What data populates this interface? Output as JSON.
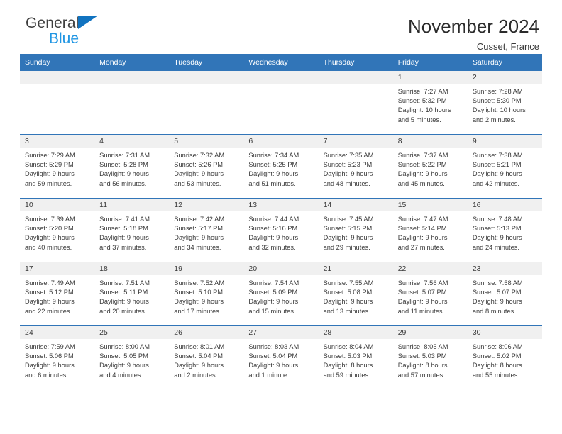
{
  "brand": {
    "name_part1": "General",
    "name_part2": "Blue",
    "triangle_color": "#1173c0",
    "blue_color": "#2196e3"
  },
  "header": {
    "title": "November 2024",
    "subtitle": "Cusset, France"
  },
  "theme": {
    "header_blue": "#3175b8",
    "day_band_gray": "#f0f0f0",
    "text_color": "#3a3a3a"
  },
  "weekdays": [
    "Sunday",
    "Monday",
    "Tuesday",
    "Wednesday",
    "Thursday",
    "Friday",
    "Saturday"
  ],
  "weeks": [
    [
      {
        "day": "",
        "lines": []
      },
      {
        "day": "",
        "lines": []
      },
      {
        "day": "",
        "lines": []
      },
      {
        "day": "",
        "lines": []
      },
      {
        "day": "",
        "lines": []
      },
      {
        "day": "1",
        "lines": [
          "Sunrise: 7:27 AM",
          "Sunset: 5:32 PM",
          "Daylight: 10 hours",
          "and 5 minutes."
        ]
      },
      {
        "day": "2",
        "lines": [
          "Sunrise: 7:28 AM",
          "Sunset: 5:30 PM",
          "Daylight: 10 hours",
          "and 2 minutes."
        ]
      }
    ],
    [
      {
        "day": "3",
        "lines": [
          "Sunrise: 7:29 AM",
          "Sunset: 5:29 PM",
          "Daylight: 9 hours",
          "and 59 minutes."
        ]
      },
      {
        "day": "4",
        "lines": [
          "Sunrise: 7:31 AM",
          "Sunset: 5:28 PM",
          "Daylight: 9 hours",
          "and 56 minutes."
        ]
      },
      {
        "day": "5",
        "lines": [
          "Sunrise: 7:32 AM",
          "Sunset: 5:26 PM",
          "Daylight: 9 hours",
          "and 53 minutes."
        ]
      },
      {
        "day": "6",
        "lines": [
          "Sunrise: 7:34 AM",
          "Sunset: 5:25 PM",
          "Daylight: 9 hours",
          "and 51 minutes."
        ]
      },
      {
        "day": "7",
        "lines": [
          "Sunrise: 7:35 AM",
          "Sunset: 5:23 PM",
          "Daylight: 9 hours",
          "and 48 minutes."
        ]
      },
      {
        "day": "8",
        "lines": [
          "Sunrise: 7:37 AM",
          "Sunset: 5:22 PM",
          "Daylight: 9 hours",
          "and 45 minutes."
        ]
      },
      {
        "day": "9",
        "lines": [
          "Sunrise: 7:38 AM",
          "Sunset: 5:21 PM",
          "Daylight: 9 hours",
          "and 42 minutes."
        ]
      }
    ],
    [
      {
        "day": "10",
        "lines": [
          "Sunrise: 7:39 AM",
          "Sunset: 5:20 PM",
          "Daylight: 9 hours",
          "and 40 minutes."
        ]
      },
      {
        "day": "11",
        "lines": [
          "Sunrise: 7:41 AM",
          "Sunset: 5:18 PM",
          "Daylight: 9 hours",
          "and 37 minutes."
        ]
      },
      {
        "day": "12",
        "lines": [
          "Sunrise: 7:42 AM",
          "Sunset: 5:17 PM",
          "Daylight: 9 hours",
          "and 34 minutes."
        ]
      },
      {
        "day": "13",
        "lines": [
          "Sunrise: 7:44 AM",
          "Sunset: 5:16 PM",
          "Daylight: 9 hours",
          "and 32 minutes."
        ]
      },
      {
        "day": "14",
        "lines": [
          "Sunrise: 7:45 AM",
          "Sunset: 5:15 PM",
          "Daylight: 9 hours",
          "and 29 minutes."
        ]
      },
      {
        "day": "15",
        "lines": [
          "Sunrise: 7:47 AM",
          "Sunset: 5:14 PM",
          "Daylight: 9 hours",
          "and 27 minutes."
        ]
      },
      {
        "day": "16",
        "lines": [
          "Sunrise: 7:48 AM",
          "Sunset: 5:13 PM",
          "Daylight: 9 hours",
          "and 24 minutes."
        ]
      }
    ],
    [
      {
        "day": "17",
        "lines": [
          "Sunrise: 7:49 AM",
          "Sunset: 5:12 PM",
          "Daylight: 9 hours",
          "and 22 minutes."
        ]
      },
      {
        "day": "18",
        "lines": [
          "Sunrise: 7:51 AM",
          "Sunset: 5:11 PM",
          "Daylight: 9 hours",
          "and 20 minutes."
        ]
      },
      {
        "day": "19",
        "lines": [
          "Sunrise: 7:52 AM",
          "Sunset: 5:10 PM",
          "Daylight: 9 hours",
          "and 17 minutes."
        ]
      },
      {
        "day": "20",
        "lines": [
          "Sunrise: 7:54 AM",
          "Sunset: 5:09 PM",
          "Daylight: 9 hours",
          "and 15 minutes."
        ]
      },
      {
        "day": "21",
        "lines": [
          "Sunrise: 7:55 AM",
          "Sunset: 5:08 PM",
          "Daylight: 9 hours",
          "and 13 minutes."
        ]
      },
      {
        "day": "22",
        "lines": [
          "Sunrise: 7:56 AM",
          "Sunset: 5:07 PM",
          "Daylight: 9 hours",
          "and 11 minutes."
        ]
      },
      {
        "day": "23",
        "lines": [
          "Sunrise: 7:58 AM",
          "Sunset: 5:07 PM",
          "Daylight: 9 hours",
          "and 8 minutes."
        ]
      }
    ],
    [
      {
        "day": "24",
        "lines": [
          "Sunrise: 7:59 AM",
          "Sunset: 5:06 PM",
          "Daylight: 9 hours",
          "and 6 minutes."
        ]
      },
      {
        "day": "25",
        "lines": [
          "Sunrise: 8:00 AM",
          "Sunset: 5:05 PM",
          "Daylight: 9 hours",
          "and 4 minutes."
        ]
      },
      {
        "day": "26",
        "lines": [
          "Sunrise: 8:01 AM",
          "Sunset: 5:04 PM",
          "Daylight: 9 hours",
          "and 2 minutes."
        ]
      },
      {
        "day": "27",
        "lines": [
          "Sunrise: 8:03 AM",
          "Sunset: 5:04 PM",
          "Daylight: 9 hours",
          "and 1 minute."
        ]
      },
      {
        "day": "28",
        "lines": [
          "Sunrise: 8:04 AM",
          "Sunset: 5:03 PM",
          "Daylight: 8 hours",
          "and 59 minutes."
        ]
      },
      {
        "day": "29",
        "lines": [
          "Sunrise: 8:05 AM",
          "Sunset: 5:03 PM",
          "Daylight: 8 hours",
          "and 57 minutes."
        ]
      },
      {
        "day": "30",
        "lines": [
          "Sunrise: 8:06 AM",
          "Sunset: 5:02 PM",
          "Daylight: 8 hours",
          "and 55 minutes."
        ]
      }
    ]
  ]
}
